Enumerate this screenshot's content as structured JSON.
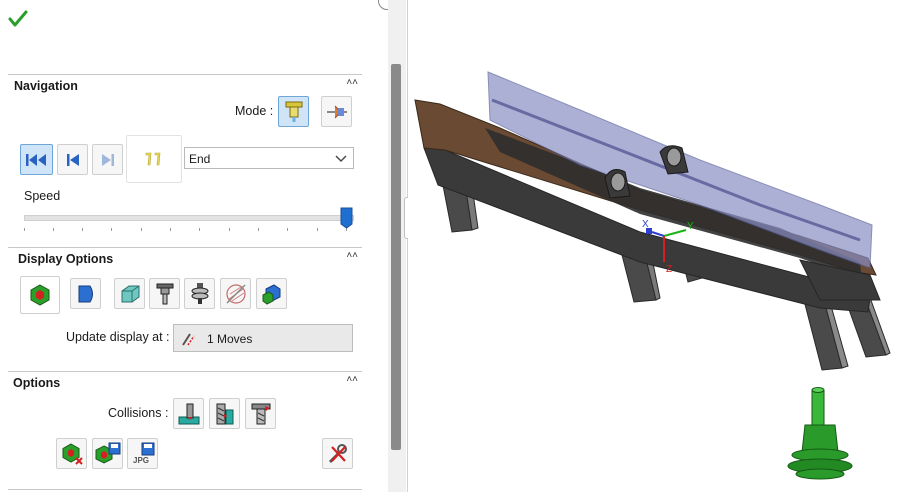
{
  "panel": {
    "confirm_icon": "green-checkmark-icon",
    "navigation": {
      "title": "Navigation",
      "mode_label": "Mode :",
      "end_select": {
        "value": "End"
      },
      "speed_label": "Speed",
      "speed_level": 1.0
    },
    "display_options": {
      "title": "Display Options",
      "update_label": "Update display at :",
      "update_value": "1 Moves"
    },
    "options": {
      "title": "Options",
      "collisions_label": "Collisions :",
      "save_icon_label": "JPG"
    }
  },
  "viewport": {
    "axis_x_label": "X",
    "axis_y_label": "Y",
    "axis_z_label": "Z",
    "colors": {
      "fixture": "#3a3a3a",
      "stock_top": "#8a8fc4",
      "stock_side": "#6b4a33",
      "tool": "#2a9a2a",
      "axis_x": "#2f3fcf",
      "axis_y": "#18b318",
      "axis_z": "#d42020"
    }
  }
}
